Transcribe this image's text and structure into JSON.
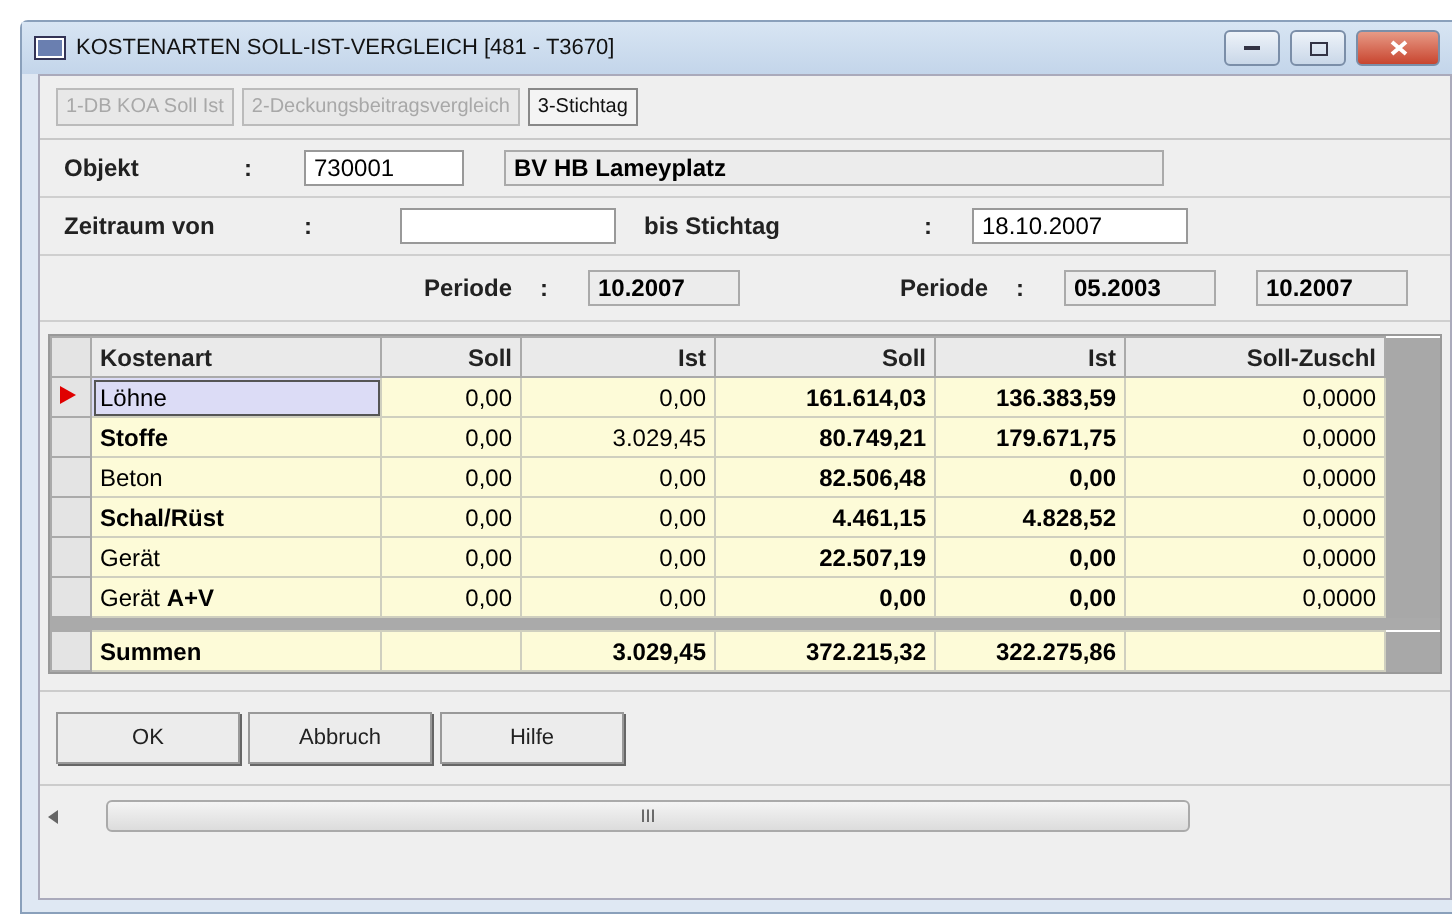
{
  "window": {
    "title": "KOSTENARTEN SOLL-IST-VERGLEICH  [481 - T3670]"
  },
  "tabs": [
    {
      "label": "1-DB KOA Soll Ist",
      "selected": false,
      "disabled": true
    },
    {
      "label": "2-Deckungsbeitragsvergleich",
      "selected": false,
      "disabled": true
    },
    {
      "label": "3-Stichtag",
      "selected": true,
      "disabled": false
    }
  ],
  "objekt": {
    "label": "Objekt",
    "sep": ":",
    "value": "730001",
    "name": "BV HB Lameyplatz"
  },
  "zeitraum": {
    "label": "Zeitraum von",
    "sep": ":",
    "bis_label": "bis Stichtag",
    "bis_sep": ":",
    "bis_value": "18.10.2007"
  },
  "periods": [
    {
      "label": "Periode",
      "sep": ":",
      "value": "10.2007"
    },
    {
      "label": "Periode",
      "sep": ":",
      "value": "05.2003",
      "value2": "10.2007"
    }
  ],
  "table": {
    "columns": [
      "Kostenart",
      "Soll",
      "Ist",
      "Soll",
      "Ist",
      "Soll-Zuschl"
    ],
    "rows": [
      {
        "selected": true,
        "cells": [
          "Löhne",
          "0,00",
          "0,00",
          "161.614,03",
          "136.383,59",
          "0,0000"
        ]
      },
      {
        "selected": false,
        "cells": [
          "**Stoffe**",
          "0,00",
          "3.029,45",
          "80.749,21",
          "179.671,75",
          "0,0000"
        ]
      },
      {
        "selected": false,
        "cells": [
          "Beton",
          "0,00",
          "0,00",
          "82.506,48",
          "0,00",
          "0,0000"
        ]
      },
      {
        "selected": false,
        "cells": [
          "**Schal/Rüst**",
          "0,00",
          "0,00",
          "4.461,15",
          "4.828,52",
          "0,0000"
        ]
      },
      {
        "selected": false,
        "cells": [
          "Gerät",
          "0,00",
          "0,00",
          "22.507,19",
          "0,00",
          "0,0000"
        ]
      },
      {
        "selected": false,
        "cells": [
          "Gerät **A+V**",
          "0,00",
          "0,00",
          "0,00",
          "0,00",
          "0,0000"
        ]
      }
    ],
    "totals": {
      "label": "Summen",
      "ist": "3.029,45",
      "soll_2": "372.215,32",
      "ist_2": "322.275,86"
    }
  },
  "buttons": [
    "OK",
    "Abbruch",
    "Hilfe"
  ],
  "scrollbar": {
    "grip": "III"
  }
}
